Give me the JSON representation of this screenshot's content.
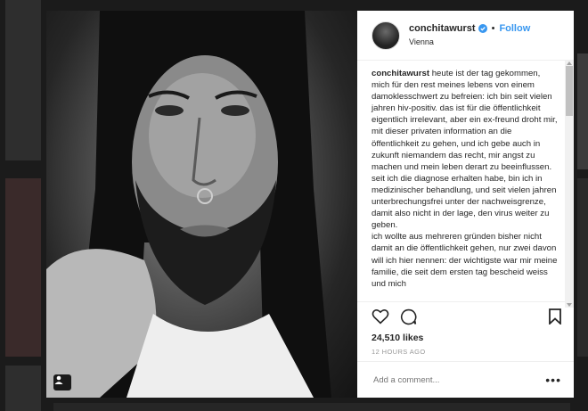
{
  "post": {
    "username": "conchitawurst",
    "follow_label": "Follow",
    "location": "Vienna",
    "caption_user": "conchitawurst",
    "caption_text": " heute ist der tag gekommen, mich für den rest meines lebens von einem damoklesschwert zu befreien: ich bin seit vielen jahren hiv-positiv. das ist für die öffentlichkeit eigentlich irrelevant, aber ein ex-freund droht mir, mit dieser privaten information an die öffentlichkeit zu gehen, und ich gebe auch in zukunft niemandem das recht, mir angst zu machen und mein leben derart zu beeinflussen.\nseit ich die diagnose erhalten habe, bin ich in medizinischer behandlung, und seit vielen jahren unterbrechungsfrei unter der nachweisgrenze, damit also nicht in der lage, den virus weiter zu geben.\nich wollte aus mehreren gründen bisher nicht damit an die öffentlichkeit gehen, nur zwei davon will ich hier nennen: der wichtigste war mir meine familie, die seit dem ersten tag bescheid weiss und mich",
    "likes": "24,510 likes",
    "time": "12 HOURS AGO",
    "comment_placeholder": "Add a comment...",
    "more_label": "•••"
  },
  "icons": {
    "verified": "verified-badge-icon",
    "like": "heart-icon",
    "comment": "comment-bubble-icon",
    "save": "bookmark-icon",
    "user_tag": "person-tag-icon"
  },
  "colors": {
    "link": "#3897f0",
    "text": "#262626",
    "muted": "#999999"
  }
}
